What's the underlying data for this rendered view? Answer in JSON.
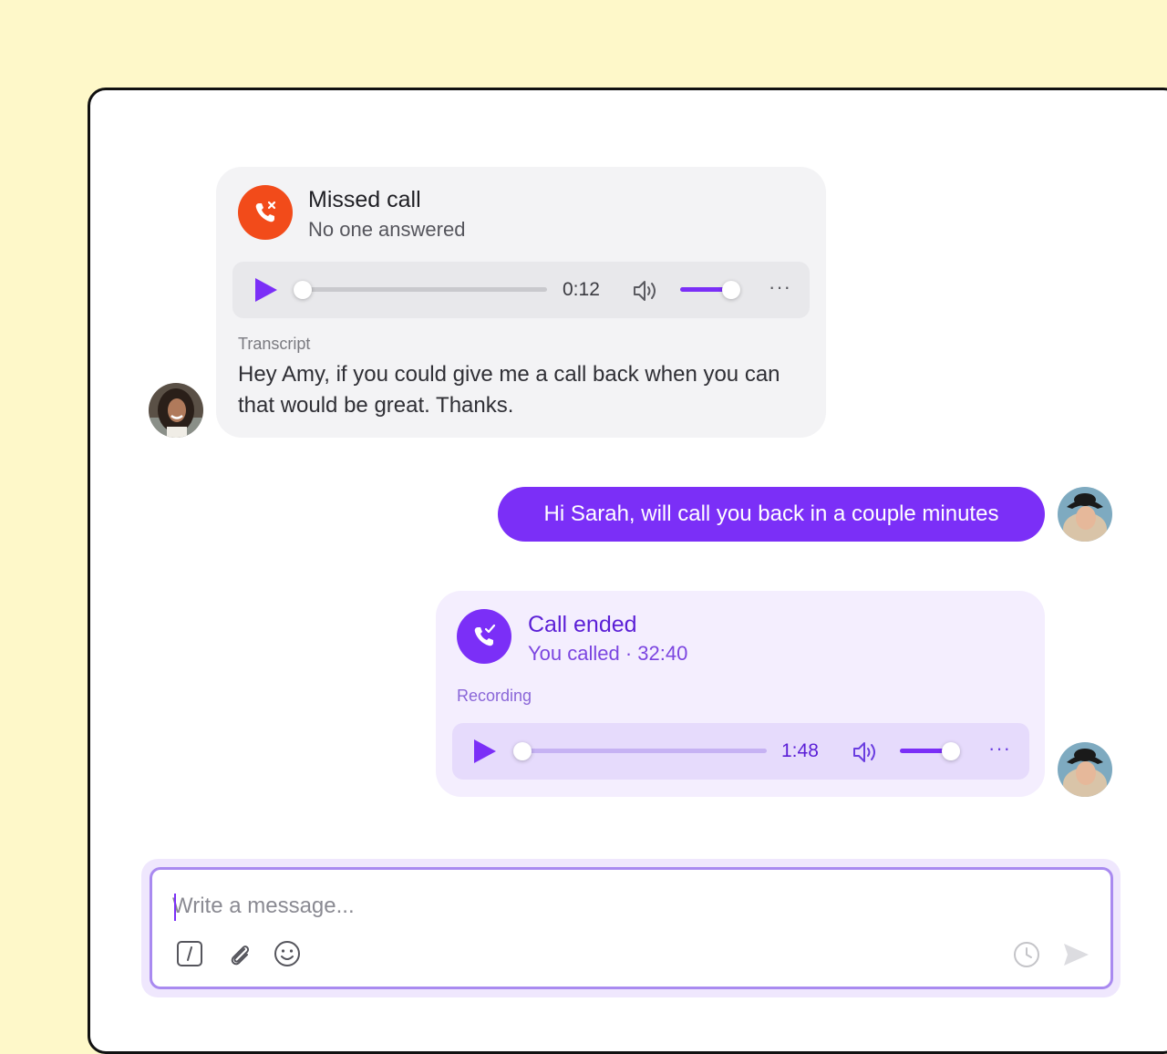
{
  "missed_call": {
    "title": "Missed call",
    "subtitle": "No one answered",
    "player": {
      "time": "0:12",
      "progress": 0.0,
      "volume": 0.75
    },
    "transcript_label": "Transcript",
    "transcript_text": "Hey Amy, if you could give me a call back when you can that would be great. Thanks."
  },
  "outgoing_message": {
    "text": "Hi Sarah, will call you back in a couple minutes"
  },
  "call_ended": {
    "title": "Call ended",
    "subtitle": "You called · 32:40",
    "recording_label": "Recording",
    "player": {
      "time": "1:48",
      "progress": 0.0,
      "volume": 0.75
    }
  },
  "composer": {
    "placeholder": "Write a message...",
    "icons": [
      "slash-command-icon",
      "paperclip-icon",
      "emoji-icon",
      "clock-icon",
      "send-icon"
    ]
  },
  "colors": {
    "background": "#fef8c9",
    "accent": "#7b2ff7",
    "missed": "#f24b1a",
    "bubble_in": "#f3f3f5",
    "bubble_call": "#f4eefe"
  }
}
